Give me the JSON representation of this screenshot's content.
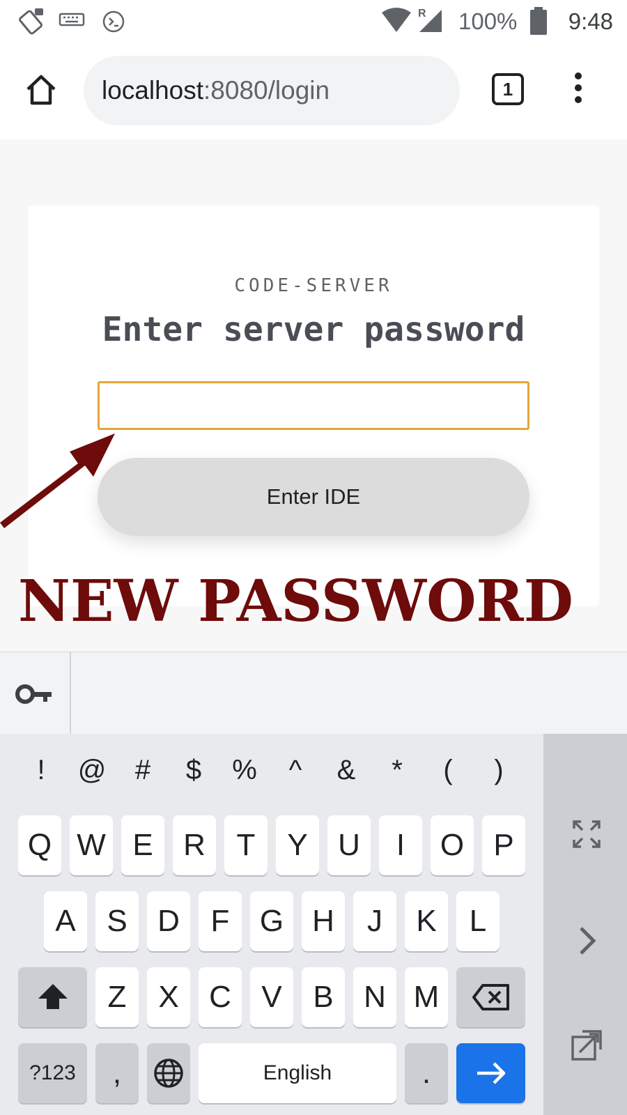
{
  "status_bar": {
    "battery": "100%",
    "time": "9:48",
    "icons": [
      "rotate-icon",
      "keyboard-icon",
      "terminal-icon",
      "wifi-icon",
      "signal-roaming-icon",
      "battery-icon"
    ]
  },
  "browser": {
    "url_host": "localhost",
    "url_rest": ":8080/login",
    "tab_count": "1"
  },
  "login": {
    "brand": "CODE-SERVER",
    "heading": "Enter server password",
    "password_value": "",
    "submit_label": "Enter IDE"
  },
  "annotation": {
    "text": "NEW PASSWORD",
    "color": "#6e0b0b"
  },
  "keyboard": {
    "symbols": [
      "!",
      "@",
      "#",
      "$",
      "%",
      "^",
      "&",
      "*",
      "(",
      ")"
    ],
    "row1": [
      "Q",
      "W",
      "E",
      "R",
      "T",
      "Y",
      "U",
      "I",
      "O",
      "P"
    ],
    "row2": [
      "A",
      "S",
      "D",
      "F",
      "G",
      "H",
      "J",
      "K",
      "L"
    ],
    "row3": [
      "Z",
      "X",
      "C",
      "V",
      "B",
      "N",
      "M"
    ],
    "numbers_key": "?123",
    "comma_key": ",",
    "space_label": "English",
    "period_key": ".",
    "enter_color": "#1a73e8"
  }
}
